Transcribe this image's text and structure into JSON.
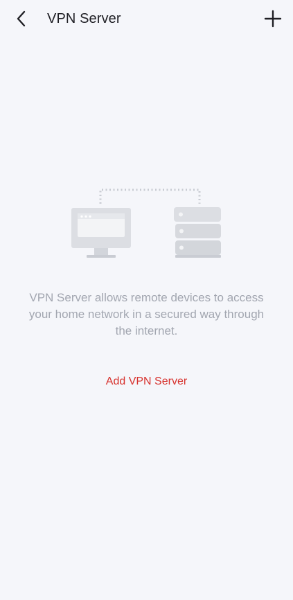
{
  "header": {
    "title": "VPN Server",
    "back_icon": "chevron-left-icon",
    "add_icon": "plus-icon"
  },
  "empty_state": {
    "illustration_icon": "computer-to-server-icon",
    "description": "VPN Server allows remote devices to access your home network in a secured way through the internet.",
    "action_label": "Add VPN Server"
  },
  "colors": {
    "background": "#f5f6fa",
    "title": "#1f1f24",
    "description": "#a2a6b0",
    "accent": "#d7322d"
  }
}
